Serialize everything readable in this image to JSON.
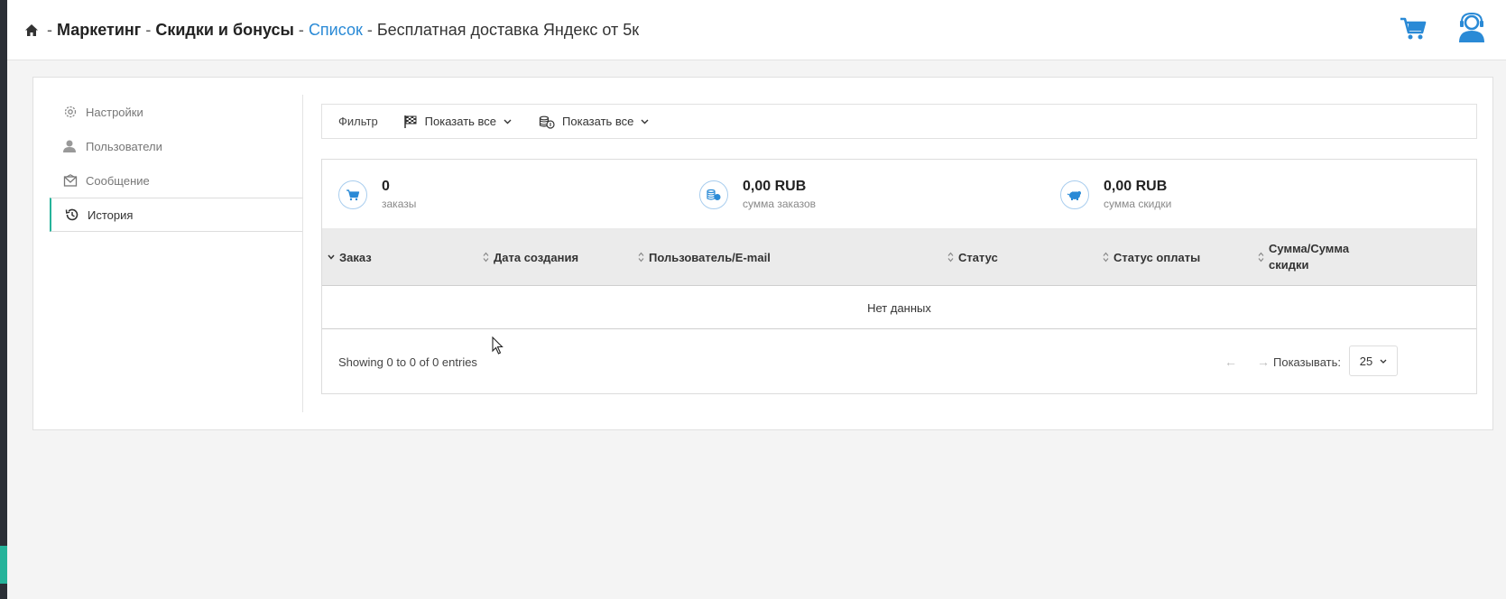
{
  "breadcrumb": {
    "sep": "-",
    "part1": "Маркетинг",
    "part2": "Скидки и бонусы",
    "link": "Список",
    "current": "Бесплатная доставка Яндекс от 5к"
  },
  "sidebar": {
    "items": [
      {
        "label": "Настройки",
        "icon": "gear-icon"
      },
      {
        "label": "Пользователи",
        "icon": "user-icon"
      },
      {
        "label": "Сообщение",
        "icon": "envelope-icon"
      },
      {
        "label": "История",
        "icon": "history-icon"
      }
    ]
  },
  "filter": {
    "label": "Фильтр",
    "dropdown1": "Показать все",
    "dropdown2": "Показать все"
  },
  "stats": [
    {
      "value": "0",
      "label": "заказы"
    },
    {
      "value": "0,00 RUB",
      "label": "сумма заказов"
    },
    {
      "value": "0,00 RUB",
      "label": "сумма скидки"
    }
  ],
  "table": {
    "columns": [
      "Заказ",
      "Дата создания",
      "Пользователь/E-mail",
      "Статус",
      "Статус оплаты",
      "Сумма/Сумма скидки"
    ],
    "col6_line1": "Сумма/Сумма",
    "col6_line2": "скидки",
    "empty": "Нет данных"
  },
  "footer": {
    "showing": "Showing 0 to 0 of 0 entries",
    "prev": "←",
    "next": "→",
    "perpage_label": "Показывать:",
    "perpage_value": "25"
  },
  "colors": {
    "accent": "#26b39a",
    "link": "#2a8ad6",
    "icon_blue": "#2a8ad6"
  }
}
